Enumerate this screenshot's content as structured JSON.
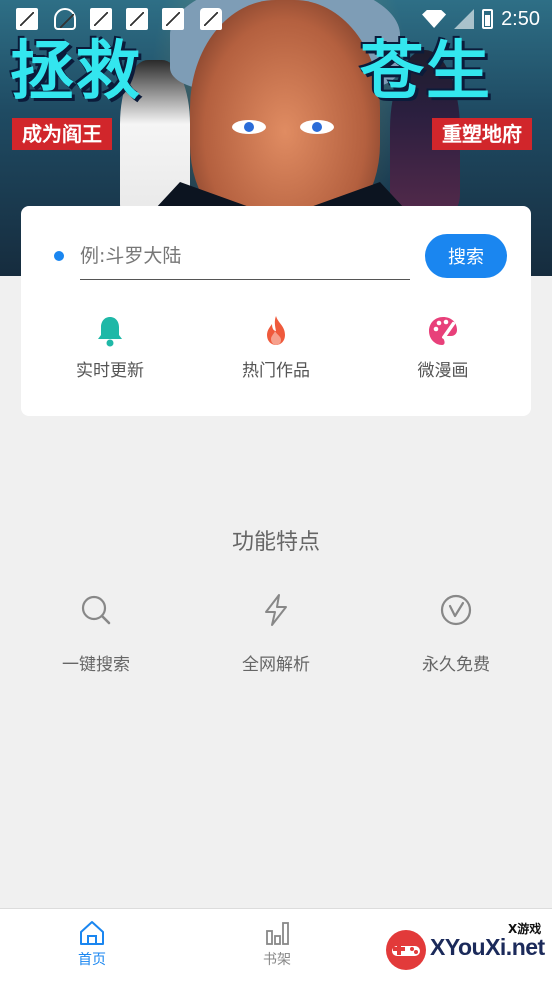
{
  "status_bar": {
    "time": "2:50",
    "notification_icons": [
      "app-notification-icon",
      "app-notification-icon",
      "app-notification-icon",
      "app-notification-icon",
      "app-notification-icon",
      "app-notification-icon"
    ]
  },
  "banner": {
    "title_left": "拯救",
    "title_right": "苍生",
    "ribbon_left": "成为阎王",
    "ribbon_right": "重塑地府"
  },
  "search": {
    "placeholder": "例:斗罗大陆",
    "button_label": "搜索"
  },
  "quick_links": [
    {
      "label": "实时更新",
      "icon": "bell-icon",
      "color": "#1fb8a7"
    },
    {
      "label": "热门作品",
      "icon": "flame-icon",
      "color": "#ef5a3c"
    },
    {
      "label": "微漫画",
      "icon": "palette-icon",
      "color": "#e8407a"
    }
  ],
  "features": {
    "title": "功能特点",
    "items": [
      {
        "label": "一键搜索",
        "icon": "search-icon"
      },
      {
        "label": "全网解析",
        "icon": "lightning-icon"
      },
      {
        "label": "永久免费",
        "icon": "checkmark-circle-icon"
      }
    ]
  },
  "bottom_nav": {
    "items": [
      {
        "label": "首页",
        "icon": "home-icon",
        "active": true
      },
      {
        "label": "书架",
        "icon": "bar-chart-icon",
        "active": false
      }
    ]
  },
  "watermark": {
    "brand": "XYouXi.net",
    "sub": "X游戏"
  },
  "colors": {
    "accent": "#1a86f0",
    "background": "#f0f0f0",
    "card": "#ffffff"
  }
}
